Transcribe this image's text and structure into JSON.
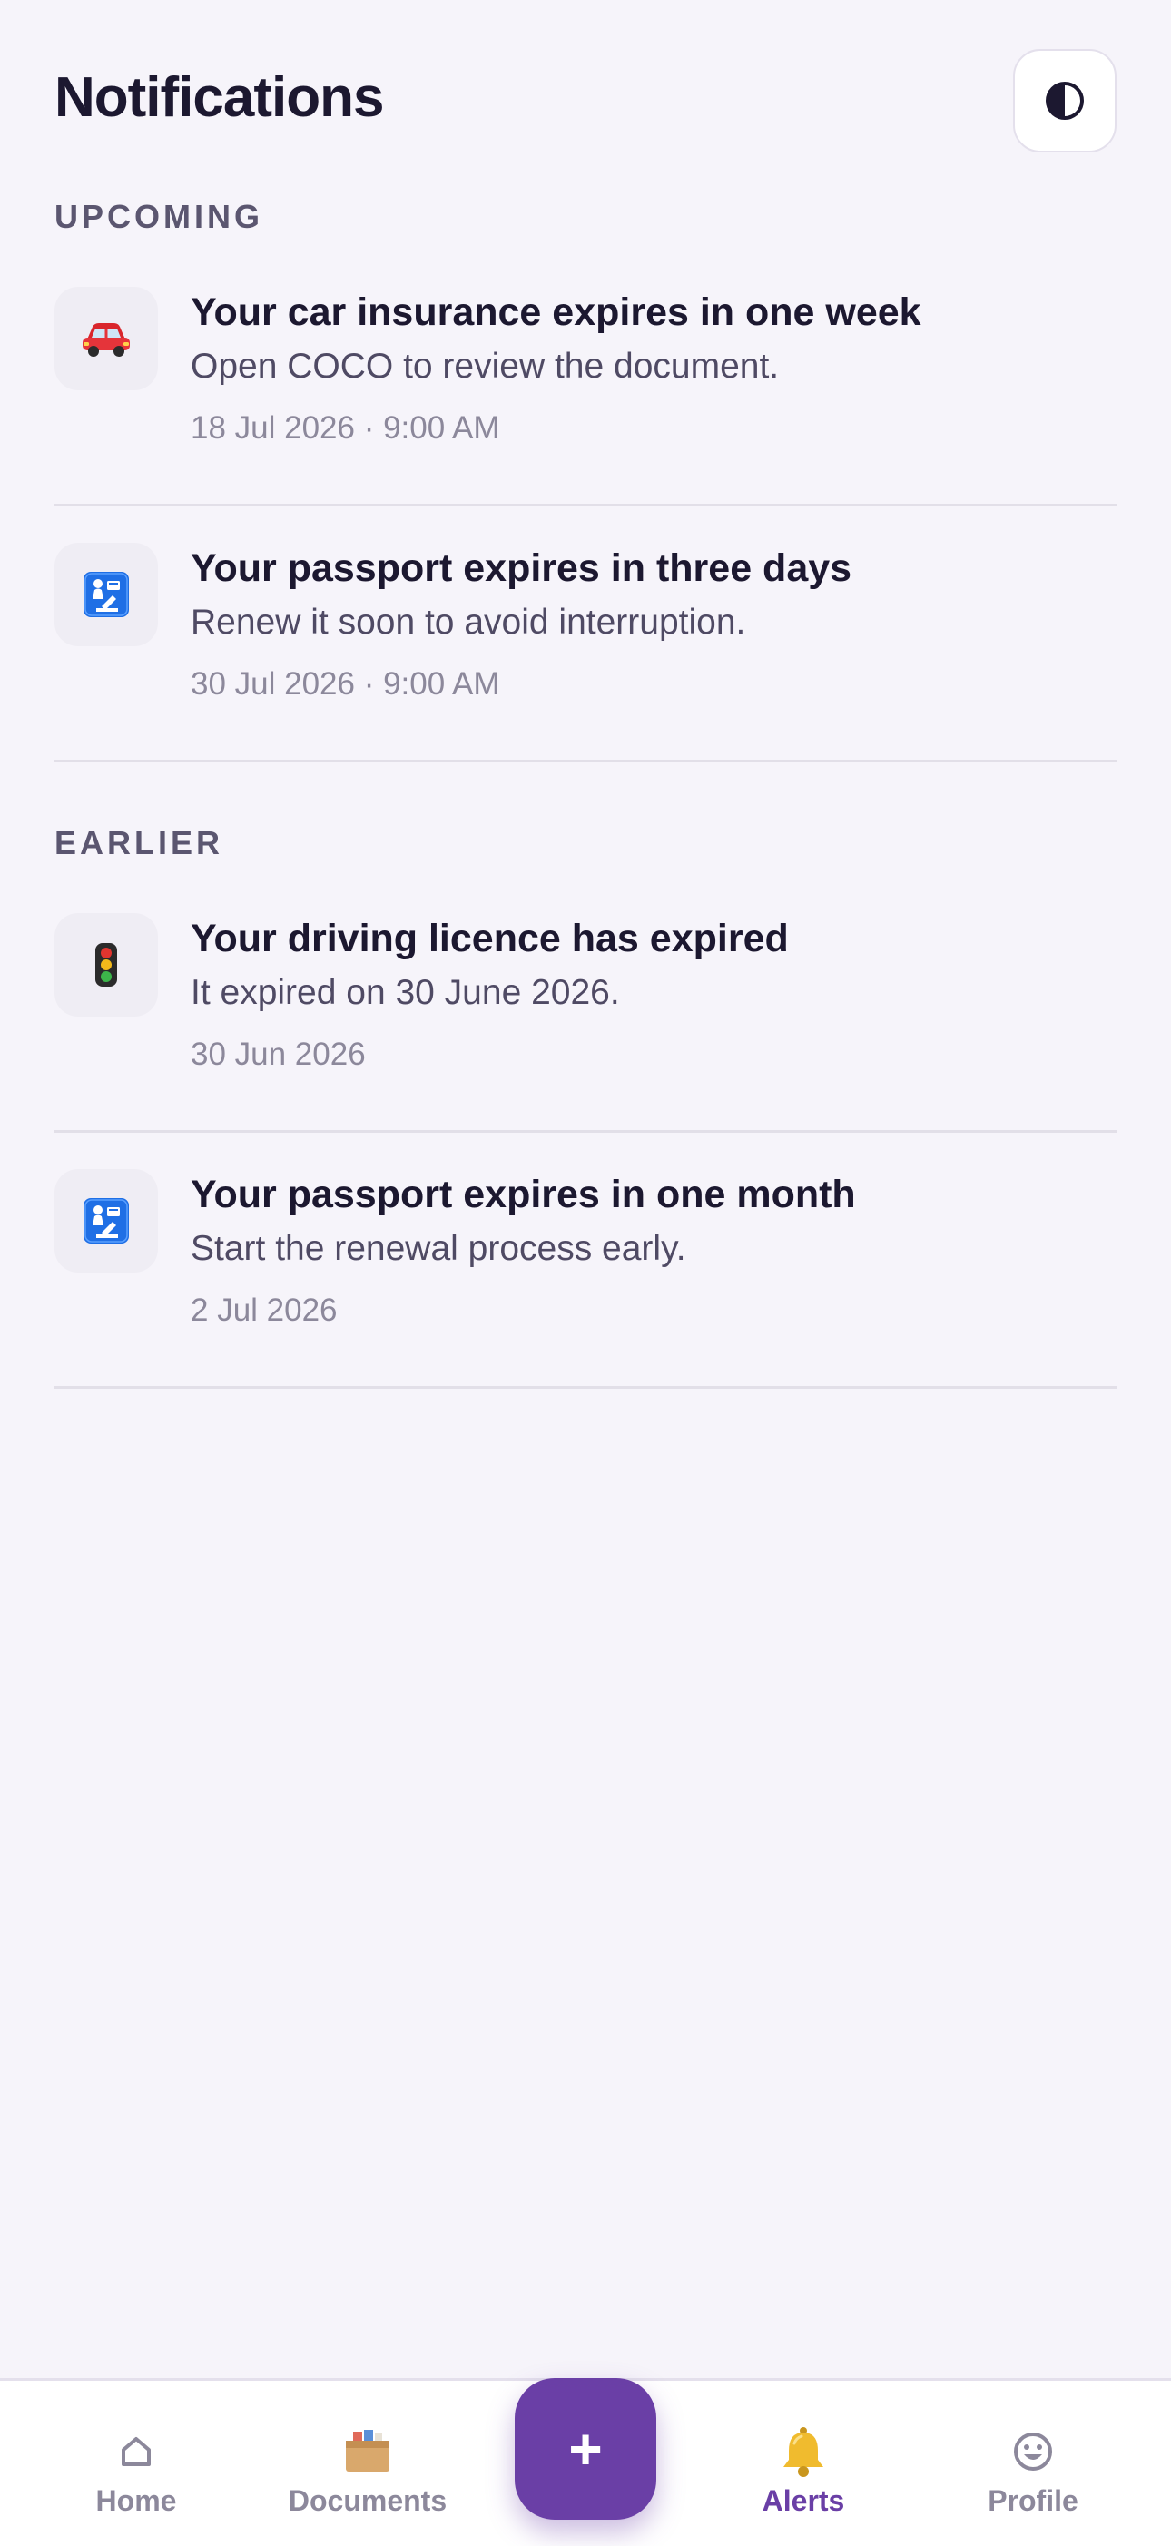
{
  "header": {
    "title": "Notifications",
    "theme_toggle_icon": "contrast-icon"
  },
  "sections": [
    {
      "label": "UPCOMING",
      "items": [
        {
          "icon": "car-icon",
          "title": "Your car insurance expires in one week",
          "body": "Open COCO to review the document.",
          "time": "18 Jul 2026 · 9:00 AM"
        },
        {
          "icon": "passport-control-icon",
          "title": "Your passport expires in three days",
          "body": "Renew it soon to avoid interruption.",
          "time": "30 Jul 2026 · 9:00 AM"
        }
      ]
    },
    {
      "label": "EARLIER",
      "items": [
        {
          "icon": "traffic-light-icon",
          "title": "Your driving licence has expired",
          "body": "It expired on 30 June 2026.",
          "time": "30 Jun 2026"
        },
        {
          "icon": "passport-control-icon",
          "title": "Your passport expires in one month",
          "body": "Start the renewal process early.",
          "time": "2 Jul 2026"
        }
      ]
    }
  ],
  "bottom_nav": {
    "items": [
      {
        "label": "Home",
        "icon": "home-icon",
        "active": false
      },
      {
        "label": "Documents",
        "icon": "documents-box-icon",
        "active": false
      },
      {
        "label": "Alerts",
        "icon": "bell-icon",
        "active": true
      },
      {
        "label": "Profile",
        "icon": "smiley-icon",
        "active": false
      }
    ],
    "fab": {
      "label": "+",
      "icon": "plus-icon"
    }
  },
  "colors": {
    "accent": "#6a3fa6",
    "background": "#f6f4fa",
    "text": "#1c1830",
    "muted": "#8c889b"
  }
}
